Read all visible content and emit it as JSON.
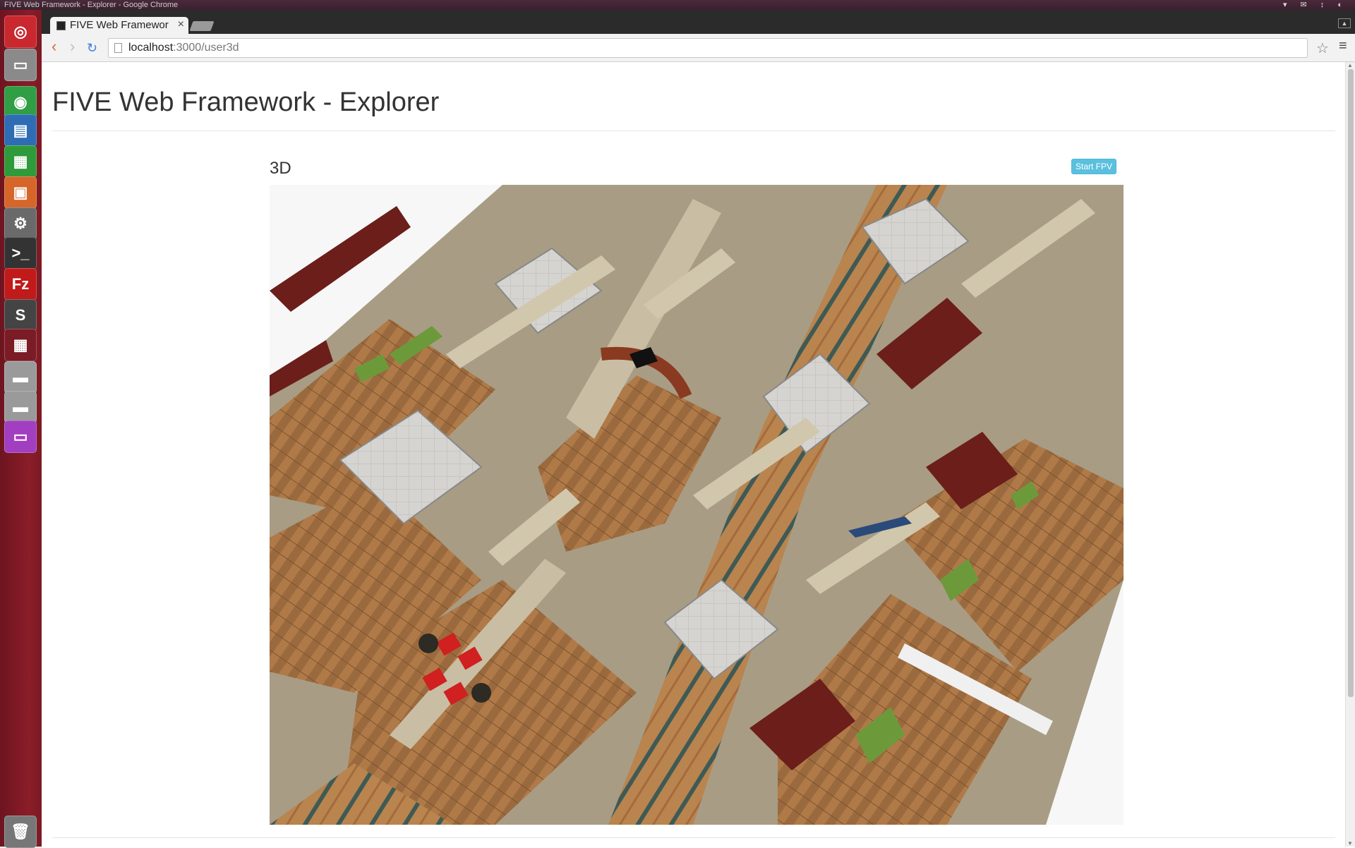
{
  "os": {
    "window_title": "FIVE Web Framework - Explorer - Google Chrome",
    "launcher": [
      {
        "name": "ubuntu-dash-icon",
        "glyph": "◎",
        "color": "#c8282e"
      },
      {
        "name": "files-icon",
        "glyph": "▭",
        "color": "#8a8a8a"
      },
      {
        "name": "chrome-icon",
        "glyph": "◉",
        "color": "#2f9e44"
      },
      {
        "name": "writer-icon",
        "glyph": "▤",
        "color": "#2e6db4"
      },
      {
        "name": "calc-icon",
        "glyph": "▦",
        "color": "#2f9a3a"
      },
      {
        "name": "impress-icon",
        "glyph": "▣",
        "color": "#d6652a"
      },
      {
        "name": "settings-icon",
        "glyph": "⚙",
        "color": "#6a6a6a"
      },
      {
        "name": "terminal-icon",
        "glyph": ">_",
        "color": "#333333"
      },
      {
        "name": "filezilla-icon",
        "glyph": "Fz",
        "color": "#c01a1a"
      },
      {
        "name": "sublime-icon",
        "glyph": "S",
        "color": "#444444"
      },
      {
        "name": "workspace-icon",
        "glyph": "▦",
        "color": "#7a1b26"
      },
      {
        "name": "drive-icon",
        "glyph": "▬",
        "color": "#9a9a9a"
      },
      {
        "name": "drive-2-icon",
        "glyph": "▬",
        "color": "#9a9a9a"
      },
      {
        "name": "app-icon",
        "glyph": "▭",
        "color": "#a23ec0"
      },
      {
        "name": "trash-icon",
        "glyph": "🗑",
        "color": "#777777"
      }
    ]
  },
  "browser": {
    "tab_title": "FIVE Web Framewor",
    "url_host": "localhost",
    "url_path": ":3000/user3d"
  },
  "page": {
    "title": "FIVE Web Framework - Explorer",
    "panel_title": "3D",
    "fpv_button": "Start FPV"
  }
}
